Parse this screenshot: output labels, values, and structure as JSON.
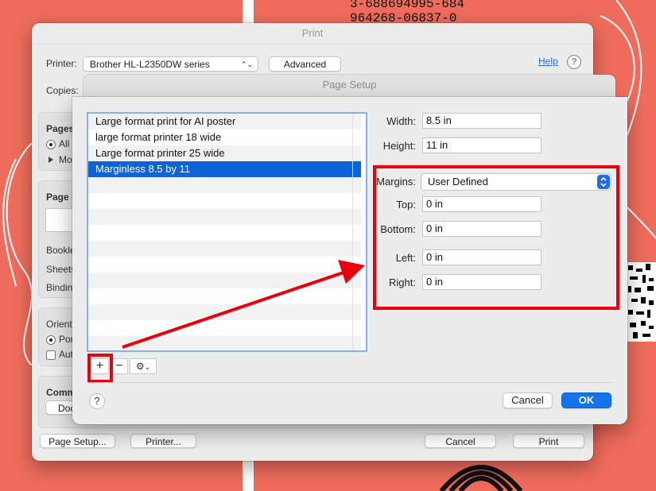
{
  "background": {
    "numbers": "3-688694995-684\n964268-06837-0"
  },
  "print_dialog": {
    "title": "Print",
    "printer_label": "Printer:",
    "printer_value": "Brother HL-L2350DW series",
    "advanced_label": "Advanced",
    "help_label": "Help",
    "help_icon": "?",
    "copies_label": "Copies:",
    "pages_label": "Pages",
    "pages_all": "All",
    "pages_more": "Mo",
    "page_section": "Page S",
    "booklet": "Bookle",
    "sheets": "Sheets",
    "binding": "Bindin",
    "orientation": "Orient",
    "orientation_portrait": "Por",
    "auto": "Aut",
    "comments": "Comm",
    "docu": "Docu",
    "page_setup_button": "Page Setup...",
    "printer_button": "Printer...",
    "cancel_button": "Cancel",
    "print_button": "Print"
  },
  "page_setup": {
    "title": "Page Setup",
    "paper_sizes": [
      {
        "label": "Large format print for AI poster"
      },
      {
        "label": "large format printer 18 wide"
      },
      {
        "label": "Large format printer 25 wide"
      },
      {
        "label": "Marginless 8.5 by 11",
        "selected": true
      }
    ],
    "width_label": "Width:",
    "width_value": "8.5 in",
    "height_label": "Height:",
    "height_value": "11 in",
    "margins_label": "Margins:",
    "margins_value": "User Defined",
    "top_label": "Top:",
    "top_value": "0 in",
    "bottom_label": "Bottom:",
    "bottom_value": "0 in",
    "left_label": "Left:",
    "left_value": "0 in",
    "right_label": "Right:",
    "right_value": "0 in",
    "add_symbol": "+",
    "remove_symbol": "−",
    "help_symbol": "?",
    "cancel_button": "Cancel",
    "ok_button": "OK"
  },
  "colors": {
    "background": "#ef6c5c",
    "accent": "#0f63d8",
    "annotation_red": "#e8000b"
  }
}
